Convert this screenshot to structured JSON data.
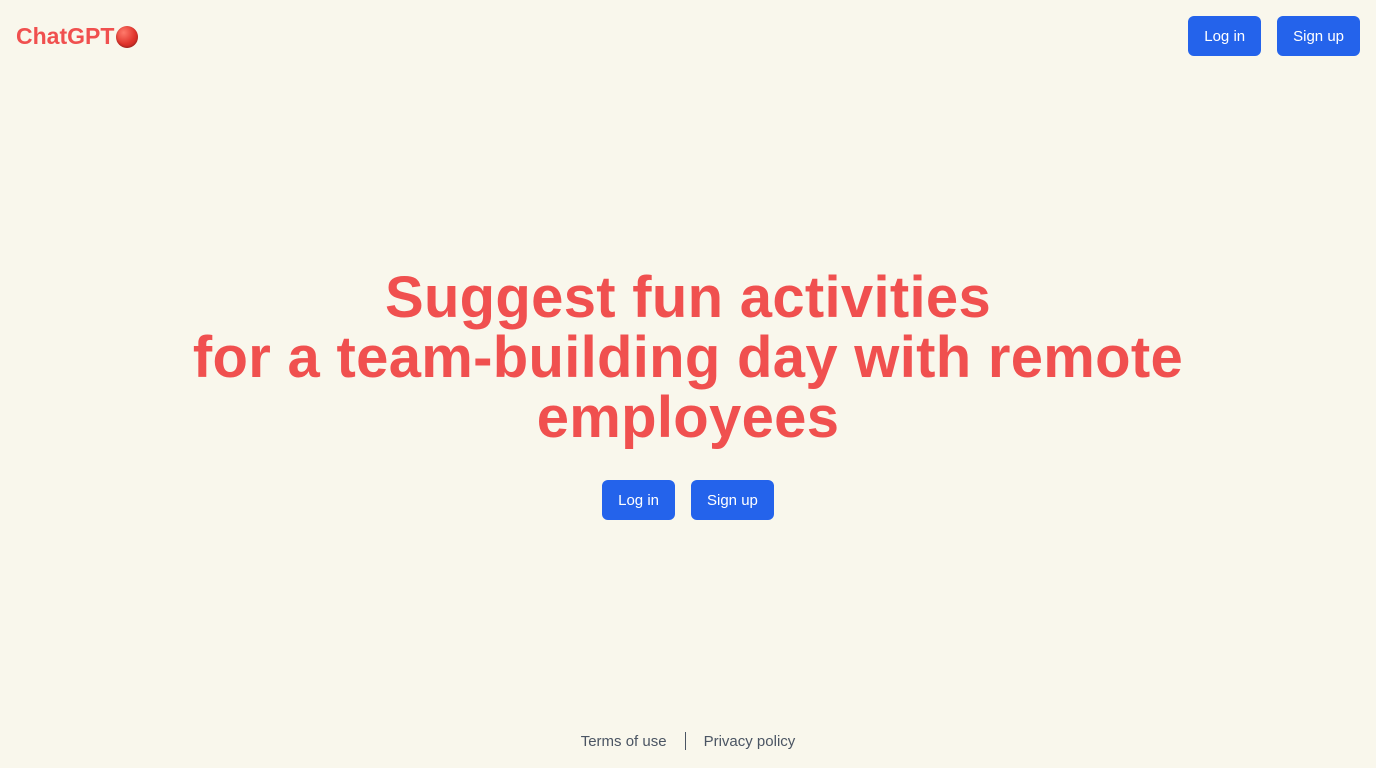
{
  "header": {
    "brand": "ChatGPT",
    "brand_icon": "red-circle-icon",
    "login_label": "Log in",
    "signup_label": "Sign up"
  },
  "hero": {
    "title_lines": [
      "Suggest fun activities",
      "for a team-building day with remote",
      "employees"
    ],
    "login_label": "Log in",
    "signup_label": "Sign up"
  },
  "footer": {
    "terms_label": "Terms of use",
    "separator": "|",
    "privacy_label": "Privacy policy"
  },
  "colors": {
    "background": "#f9f7ec",
    "accent_red": "#f0504f",
    "button_blue": "#2463eb",
    "footer_text": "#4b5563"
  }
}
